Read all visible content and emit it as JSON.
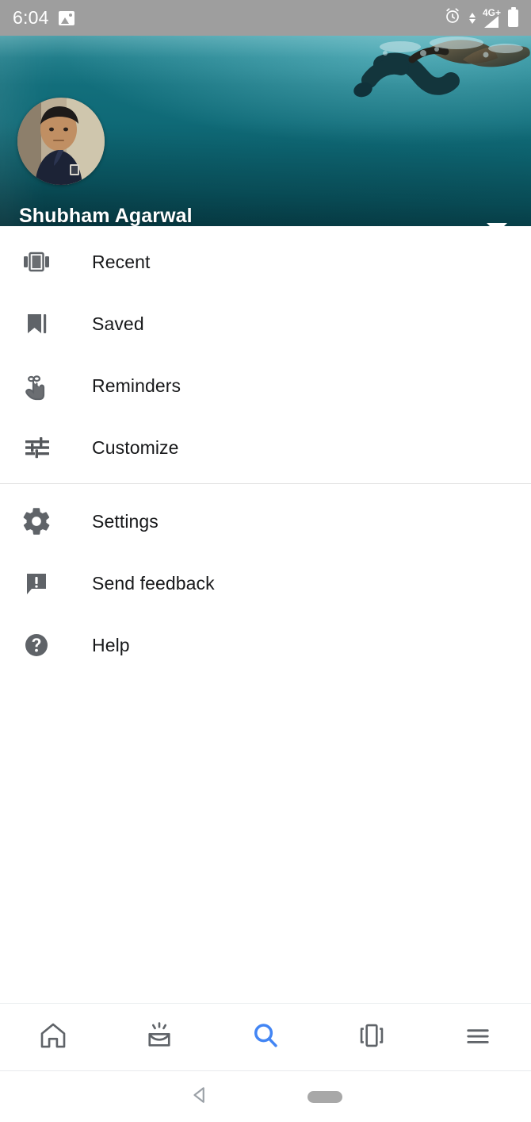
{
  "statusbar": {
    "time": "6:04",
    "icons": [
      "photo-icon",
      "alarm-icon",
      "data-transfer-icon",
      "signal-icon",
      "battery-icon"
    ],
    "network_label": "4G+",
    "background_color": "#9e9e9e"
  },
  "account": {
    "name": "Shubham Agarwal",
    "email_redacted": true,
    "avatar_alt": "profile-photo",
    "cover_description": "underwater-freediver-photo",
    "expand_label": "expand-account-list",
    "cover_color": "#0e6875"
  },
  "menu": {
    "primary": [
      {
        "id": "recent",
        "label": "Recent",
        "icon": "carousel-icon"
      },
      {
        "id": "saved",
        "label": "Saved",
        "icon": "bookmark-icon"
      },
      {
        "id": "reminders",
        "label": "Reminders",
        "icon": "finger-string-icon"
      },
      {
        "id": "customize",
        "label": "Customize",
        "icon": "tune-sliders-icon"
      }
    ],
    "secondary": [
      {
        "id": "settings",
        "label": "Settings",
        "icon": "gear-icon"
      },
      {
        "id": "send-feedback",
        "label": "Send feedback",
        "icon": "feedback-icon"
      },
      {
        "id": "help",
        "label": "Help",
        "icon": "help-circle-icon"
      }
    ]
  },
  "bottom_nav": {
    "active": "search",
    "active_color": "#4285f4",
    "inactive_color": "#5f6368",
    "items": [
      {
        "id": "home",
        "icon": "home-icon",
        "label": "Home"
      },
      {
        "id": "updates",
        "icon": "inbox-rays-icon",
        "label": "Updates"
      },
      {
        "id": "search",
        "icon": "search-icon",
        "label": "Search"
      },
      {
        "id": "tabs",
        "icon": "tabs-carousel-icon",
        "label": "Collections"
      },
      {
        "id": "more",
        "icon": "hamburger-icon",
        "label": "More"
      }
    ]
  },
  "system_nav": {
    "items": [
      {
        "id": "back",
        "icon": "back-triangle-icon"
      },
      {
        "id": "home",
        "icon": "home-pill-icon"
      }
    ]
  }
}
